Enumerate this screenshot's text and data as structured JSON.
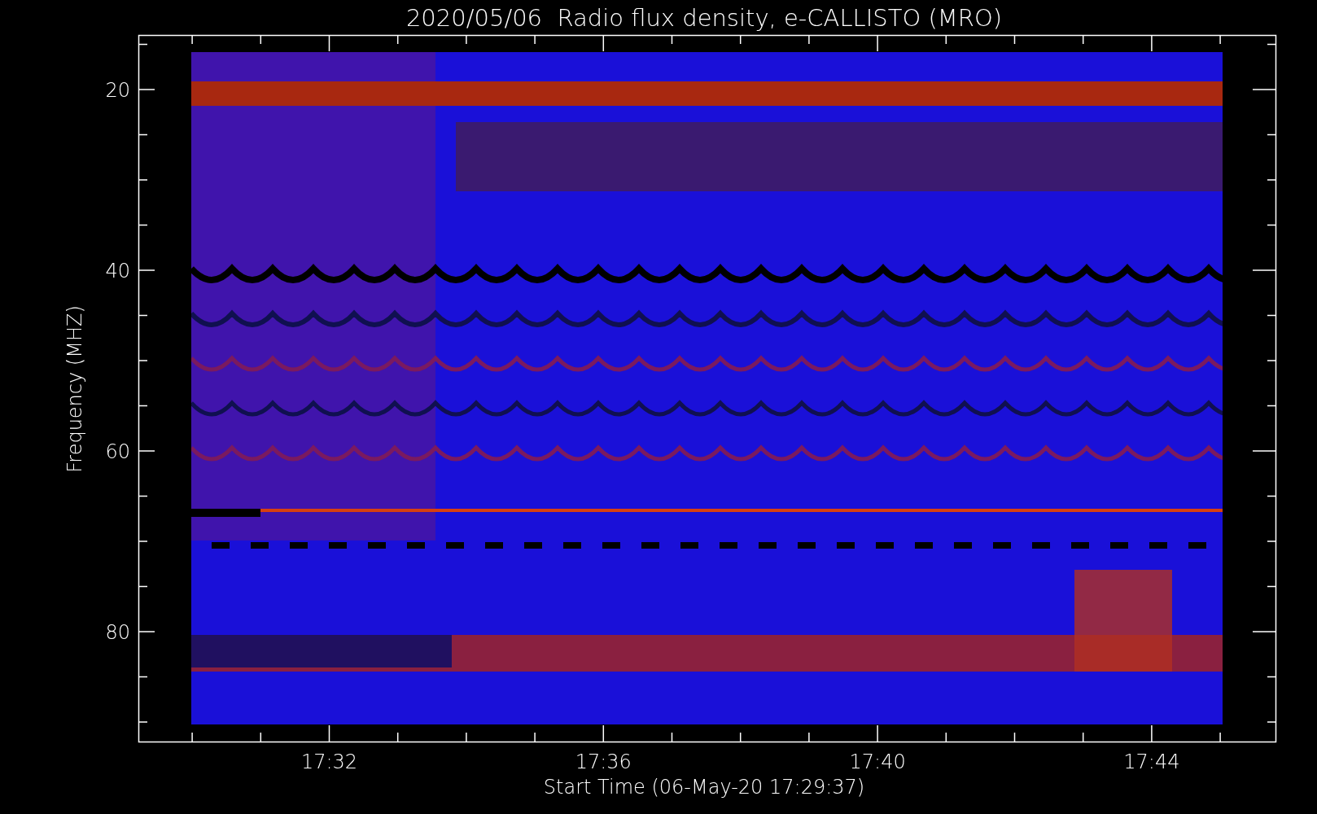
{
  "title": "2020/05/06  Radio flux density, e-CALLISTO (MRO)",
  "y_axis": {
    "label": "Frequency (MHZ)",
    "ticks": [
      "20",
      "40",
      "60",
      "80"
    ]
  },
  "x_axis": {
    "label": "Start Time (06-May-20 17:29:37)",
    "ticks": [
      "17:32",
      "17:36",
      "17:40",
      "17:44"
    ]
  }
}
